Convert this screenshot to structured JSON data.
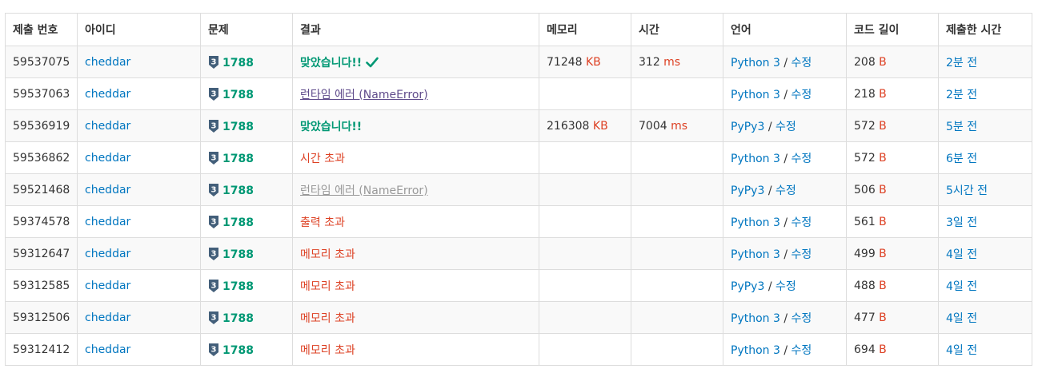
{
  "headers": [
    "제출 번호",
    "아이디",
    "문제",
    "결과",
    "메모리",
    "시간",
    "언어",
    "코드 길이",
    "제출한 시간"
  ],
  "tier_level": "3",
  "slash": " / ",
  "units": {
    "memory": "KB",
    "time": "ms",
    "length": "B"
  },
  "rows": [
    {
      "id": "59537075",
      "user": "cheddar",
      "problem": "1788",
      "result": "맞았습니다!!",
      "result_type": "ac-check",
      "memory": "71248",
      "time": "312",
      "lang": "Python 3",
      "edit": "수정",
      "length": "208",
      "when": "2분 전"
    },
    {
      "id": "59537063",
      "user": "cheddar",
      "problem": "1788",
      "result": "런타임 에러 (NameError)",
      "result_type": "rte",
      "memory": "",
      "time": "",
      "lang": "Python 3",
      "edit": "수정",
      "length": "218",
      "when": "2분 전"
    },
    {
      "id": "59536919",
      "user": "cheddar",
      "problem": "1788",
      "result": "맞았습니다!!",
      "result_type": "ac",
      "memory": "216308",
      "time": "7004",
      "lang": "PyPy3",
      "edit": "수정",
      "length": "572",
      "when": "5분 전"
    },
    {
      "id": "59536862",
      "user": "cheddar",
      "problem": "1788",
      "result": "시간 초과",
      "result_type": "red",
      "memory": "",
      "time": "",
      "lang": "Python 3",
      "edit": "수정",
      "length": "572",
      "when": "6분 전"
    },
    {
      "id": "59521468",
      "user": "cheddar",
      "problem": "1788",
      "result": "런타임 에러 (NameError)",
      "result_type": "rte-gray",
      "memory": "",
      "time": "",
      "lang": "PyPy3",
      "edit": "수정",
      "length": "506",
      "when": "5시간 전"
    },
    {
      "id": "59374578",
      "user": "cheddar",
      "problem": "1788",
      "result": "출력 초과",
      "result_type": "red",
      "memory": "",
      "time": "",
      "lang": "Python 3",
      "edit": "수정",
      "length": "561",
      "when": "3일 전"
    },
    {
      "id": "59312647",
      "user": "cheddar",
      "problem": "1788",
      "result": "메모리 초과",
      "result_type": "red",
      "memory": "",
      "time": "",
      "lang": "Python 3",
      "edit": "수정",
      "length": "499",
      "when": "4일 전"
    },
    {
      "id": "59312585",
      "user": "cheddar",
      "problem": "1788",
      "result": "메모리 초과",
      "result_type": "red",
      "memory": "",
      "time": "",
      "lang": "PyPy3",
      "edit": "수정",
      "length": "488",
      "when": "4일 전"
    },
    {
      "id": "59312506",
      "user": "cheddar",
      "problem": "1788",
      "result": "메모리 초과",
      "result_type": "red",
      "memory": "",
      "time": "",
      "lang": "Python 3",
      "edit": "수정",
      "length": "477",
      "when": "4일 전"
    },
    {
      "id": "59312412",
      "user": "cheddar",
      "problem": "1788",
      "result": "메모리 초과",
      "result_type": "red",
      "memory": "",
      "time": "",
      "lang": "Python 3",
      "edit": "수정",
      "length": "694",
      "when": "4일 전"
    }
  ]
}
